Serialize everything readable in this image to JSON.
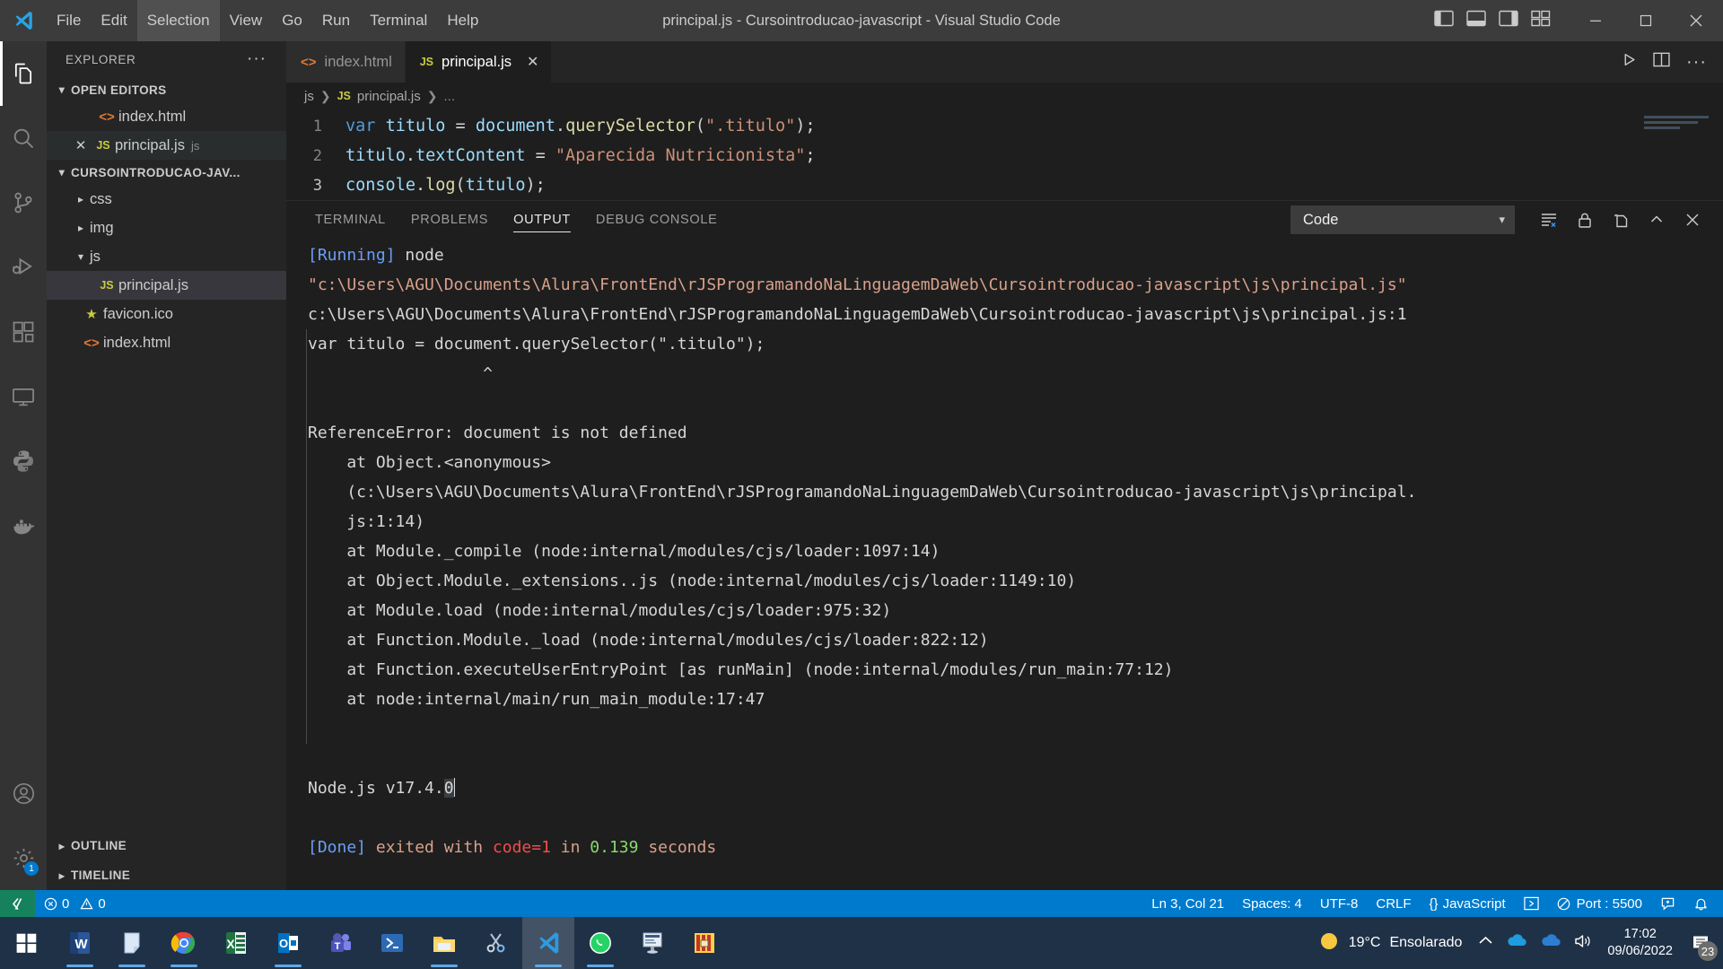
{
  "titlebar": {
    "window_title": "principal.js - Cursointroducao-javascript - Visual Studio Code",
    "menus": [
      {
        "label": "File",
        "active": false
      },
      {
        "label": "Edit",
        "active": false
      },
      {
        "label": "Selection",
        "active": true
      },
      {
        "label": "View",
        "active": false
      },
      {
        "label": "Go",
        "active": false
      },
      {
        "label": "Run",
        "active": false
      },
      {
        "label": "Terminal",
        "active": false
      },
      {
        "label": "Help",
        "active": false
      }
    ],
    "layout_icons": [
      "toggle-primary-sidebar-icon",
      "toggle-panel-icon",
      "toggle-secondary-sidebar-icon",
      "customize-layout-icon"
    ],
    "window_controls": [
      "minimize",
      "maximize",
      "close"
    ]
  },
  "activitybar": {
    "items": [
      {
        "name": "explorer",
        "active": true
      },
      {
        "name": "search",
        "active": false
      },
      {
        "name": "source-control",
        "active": false
      },
      {
        "name": "run-and-debug",
        "active": false
      },
      {
        "name": "extensions",
        "active": false
      },
      {
        "name": "remote-explorer",
        "active": false
      },
      {
        "name": "python",
        "active": false
      },
      {
        "name": "docker",
        "active": false
      }
    ],
    "bottom_items": [
      {
        "name": "accounts",
        "badge": ""
      },
      {
        "name": "settings",
        "badge": "1"
      }
    ]
  },
  "sidebar": {
    "title": "EXPLORER",
    "more_actions": "···",
    "open_editors": {
      "label": "OPEN EDITORS",
      "expanded": true,
      "items": [
        {
          "name": "index.html",
          "icon": "html-file-icon",
          "suffix": "",
          "active": false,
          "has_close": false
        },
        {
          "name": "principal.js",
          "icon": "js-file-icon",
          "suffix": "js",
          "active": true,
          "has_close": true
        }
      ]
    },
    "workspace": {
      "label": "CURSOINTRODUCAO-JAV...",
      "expanded": true,
      "items": [
        {
          "name": "css",
          "type": "folder",
          "expanded": false,
          "depth": 1,
          "selected": false
        },
        {
          "name": "img",
          "type": "folder",
          "expanded": false,
          "depth": 1,
          "selected": false
        },
        {
          "name": "js",
          "type": "folder",
          "expanded": true,
          "depth": 1,
          "selected": false
        },
        {
          "name": "principal.js",
          "type": "js",
          "depth": 2,
          "selected": true
        },
        {
          "name": "favicon.ico",
          "type": "ico",
          "depth": 1,
          "selected": false
        },
        {
          "name": "index.html",
          "type": "html",
          "depth": 1,
          "selected": false
        }
      ]
    },
    "collapsed_sections": [
      {
        "label": "OUTLINE"
      },
      {
        "label": "TIMELINE"
      }
    ]
  },
  "editor": {
    "tabs": [
      {
        "label": "index.html",
        "icon": "html-file-icon",
        "active": false,
        "closable": false
      },
      {
        "label": "principal.js",
        "icon": "js-file-icon",
        "active": true,
        "closable": true
      }
    ],
    "tab_actions": [
      "run-file-icon",
      "split-editor-icon",
      "more-actions-icon"
    ],
    "breadcrumb": [
      "js",
      "principal.js",
      "..."
    ],
    "code_lines": [
      {
        "number": "1",
        "current": false,
        "tokens": [
          {
            "t": "var",
            "c": "key"
          },
          {
            "t": " ",
            "c": "plain"
          },
          {
            "t": "titulo",
            "c": "var"
          },
          {
            "t": " ",
            "c": "plain"
          },
          {
            "t": "=",
            "c": "op"
          },
          {
            "t": " ",
            "c": "plain"
          },
          {
            "t": "document",
            "c": "var"
          },
          {
            "t": ".",
            "c": "op"
          },
          {
            "t": "querySelector",
            "c": "fn"
          },
          {
            "t": "(",
            "c": "op"
          },
          {
            "t": "\".titulo\"",
            "c": "str"
          },
          {
            "t": ");",
            "c": "op"
          }
        ]
      },
      {
        "number": "2",
        "current": false,
        "tokens": [
          {
            "t": "titulo",
            "c": "var"
          },
          {
            "t": ".",
            "c": "op"
          },
          {
            "t": "textContent",
            "c": "var"
          },
          {
            "t": " ",
            "c": "plain"
          },
          {
            "t": "=",
            "c": "op"
          },
          {
            "t": " ",
            "c": "plain"
          },
          {
            "t": "\"Aparecida Nutricionista\"",
            "c": "str"
          },
          {
            "t": ";",
            "c": "op"
          }
        ]
      },
      {
        "number": "3",
        "current": true,
        "tokens": [
          {
            "t": "console",
            "c": "var"
          },
          {
            "t": ".",
            "c": "op"
          },
          {
            "t": "log",
            "c": "fn"
          },
          {
            "t": "(",
            "c": "op"
          },
          {
            "t": "titulo",
            "c": "var"
          },
          {
            "t": ");",
            "c": "op"
          }
        ]
      }
    ]
  },
  "panel": {
    "tabs": [
      {
        "label": "TERMINAL",
        "active": false
      },
      {
        "label": "PROBLEMS",
        "active": false
      },
      {
        "label": "OUTPUT",
        "active": true
      },
      {
        "label": "DEBUG CONSOLE",
        "active": false
      }
    ],
    "output_channel": "Code",
    "actions": [
      "clear-output-icon",
      "lock-scroll-icon",
      "open-in-editor-icon",
      "maximize-panel-icon",
      "close-panel-icon"
    ],
    "output_lines": [
      [
        {
          "t": "[Running] ",
          "c": "o-blue"
        },
        {
          "t": "node",
          "c": "o-white"
        }
      ],
      [
        {
          "t": "\"c:\\Users\\AGU\\Documents\\Alura\\FrontEnd\\rJSProgramandoNaLinguagemDaWeb\\Cursointroducao-javascript\\js\\principal.js\"",
          "c": "o-salmon"
        }
      ],
      [
        {
          "t": "c:\\Users\\AGU\\Documents\\Alura\\FrontEnd\\rJSProgramandoNaLinguagemDaWeb\\Cursointroducao-javascript\\js\\principal.js:1",
          "c": "o-white"
        }
      ],
      [
        {
          "t": "var titulo = document.querySelector(\".titulo\");",
          "c": "o-white"
        }
      ],
      [
        {
          "t": "                  ^",
          "c": "o-white"
        }
      ],
      [
        {
          "t": "",
          "c": "o-white"
        }
      ],
      [
        {
          "t": "ReferenceError: document is not defined",
          "c": "o-white"
        }
      ],
      [
        {
          "t": "    at Object.<anonymous> ",
          "c": "o-white"
        }
      ],
      [
        {
          "t": "    (c:\\Users\\AGU\\Documents\\Alura\\FrontEnd\\rJSProgramandoNaLinguagemDaWeb\\Cursointroducao-javascript\\js\\principal.",
          "c": "o-white"
        }
      ],
      [
        {
          "t": "    js:1:14)",
          "c": "o-white"
        }
      ],
      [
        {
          "t": "    at Module._compile (node:internal/modules/cjs/loader:1097:14)",
          "c": "o-white"
        }
      ],
      [
        {
          "t": "    at Object.Module._extensions..js (node:internal/modules/cjs/loader:1149:10)",
          "c": "o-white"
        }
      ],
      [
        {
          "t": "    at Module.load (node:internal/modules/cjs/loader:975:32)",
          "c": "o-white"
        }
      ],
      [
        {
          "t": "    at Function.Module._load (node:internal/modules/cjs/loader:822:12)",
          "c": "o-white"
        }
      ],
      [
        {
          "t": "    at Function.executeUserEntryPoint [as runMain] (node:internal/modules/run_main:77:12)",
          "c": "o-white"
        }
      ],
      [
        {
          "t": "    at node:internal/main/run_main_module:17:47",
          "c": "o-white"
        }
      ],
      [
        {
          "t": "",
          "c": "o-white"
        }
      ],
      [
        {
          "t": "",
          "c": "o-white"
        }
      ],
      [
        {
          "t": "Node.js v17.4.",
          "c": "o-white"
        },
        {
          "t": "0",
          "c": "o-white sel-hl"
        }
      ],
      [
        {
          "t": "",
          "c": "o-white"
        }
      ],
      [
        {
          "t": "[Done] ",
          "c": "o-blue"
        },
        {
          "t": "exited with ",
          "c": "o-salmon"
        },
        {
          "t": "code=1",
          "c": "o-red"
        },
        {
          "t": " in ",
          "c": "o-salmon"
        },
        {
          "t": "0.139",
          "c": "o-green"
        },
        {
          "t": " seconds",
          "c": "o-salmon"
        }
      ]
    ]
  },
  "statusbar": {
    "remote_icon": "remote-window-icon",
    "errors": "0",
    "warnings": "0",
    "right_items": [
      {
        "label": "Ln 3, Col 21",
        "name": "cursor-position"
      },
      {
        "label": "Spaces: 4",
        "name": "indentation"
      },
      {
        "label": "UTF-8",
        "name": "encoding"
      },
      {
        "label": "CRLF",
        "name": "line-ending"
      },
      {
        "label": "JavaScript",
        "name": "language-mode",
        "prefix": "{}"
      },
      {
        "label": "",
        "name": "go-live-icon"
      },
      {
        "label": "Port : 5500",
        "name": "live-server-port"
      },
      {
        "label": "",
        "name": "feedback-icon"
      },
      {
        "label": "",
        "name": "notifications-bell-icon"
      }
    ]
  },
  "taskbar": {
    "start": "windows-start-icon",
    "apps": [
      {
        "name": "word-icon",
        "color": "#2b579a",
        "glyph": "W",
        "active": false,
        "open": false
      },
      {
        "name": "sticky-notes-icon",
        "color": "#d7e4f2",
        "glyph": "",
        "active": false,
        "open": true
      },
      {
        "name": "chrome-icon",
        "color": "#ea4335",
        "glyph": "",
        "active": false,
        "open": true
      },
      {
        "name": "excel-icon",
        "color": "#217346",
        "glyph": "X",
        "active": false,
        "open": false
      },
      {
        "name": "outlook-icon",
        "color": "#0072c6",
        "glyph": "O",
        "active": false,
        "open": true
      },
      {
        "name": "teams-icon",
        "color": "#5558af",
        "glyph": "T",
        "active": false,
        "open": false
      },
      {
        "name": "powershell-icon",
        "color": "#2d6ab4",
        "glyph": "〉",
        "active": false,
        "open": false
      },
      {
        "name": "file-explorer-icon",
        "color": "#ffc83d",
        "glyph": "",
        "active": false,
        "open": true
      },
      {
        "name": "snipping-tool-icon",
        "color": "#d0d0d8",
        "glyph": "",
        "active": false,
        "open": false
      },
      {
        "name": "vscode-icon",
        "color": "#2f9ae0",
        "glyph": "",
        "active": true,
        "open": true
      },
      {
        "name": "whatsapp-icon",
        "color": "#25d366",
        "glyph": "",
        "active": false,
        "open": true
      },
      {
        "name": "powerpoint-icon",
        "color": "#d24726",
        "glyph": "",
        "active": false,
        "open": false
      },
      {
        "name": "winrar-icon",
        "color": "#c6332c",
        "glyph": "",
        "active": false,
        "open": false
      }
    ],
    "tray": {
      "weather_temp": "19°C",
      "weather_desc": "Ensolarado",
      "weather_icon": "sun-icon",
      "overflow_icon": "show-hidden-icons-chevron",
      "icons": [
        "onedrive-personal-icon",
        "onedrive-business-icon",
        "volume-icon"
      ],
      "time": "17:02",
      "date": "09/06/2022",
      "notification_count": "23"
    }
  }
}
